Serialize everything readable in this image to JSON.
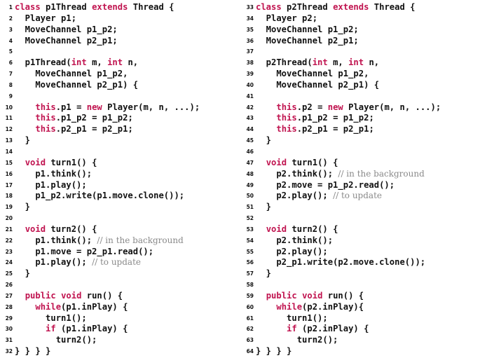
{
  "colors": {
    "keyword": "#c0134f",
    "comment": "#8a8a8a",
    "text": "#111111",
    "background": "#ffffff"
  },
  "listings": [
    {
      "name": "p1Thread",
      "lines": [
        {
          "n": "1",
          "parts": [
            {
              "t": "kw",
              "s": "class"
            },
            {
              "t": "c",
              "s": " p1Thread "
            },
            {
              "t": "kw",
              "s": "extends"
            },
            {
              "t": "c",
              "s": " Thread {"
            }
          ]
        },
        {
          "n": "2",
          "parts": [
            {
              "t": "c",
              "s": "  Player p1;"
            }
          ]
        },
        {
          "n": "3",
          "parts": [
            {
              "t": "c",
              "s": "  MoveChannel p1_p2;"
            }
          ]
        },
        {
          "n": "4",
          "parts": [
            {
              "t": "c",
              "s": "  MoveChannel p2_p1;"
            }
          ]
        },
        {
          "n": "5",
          "parts": []
        },
        {
          "n": "6",
          "parts": [
            {
              "t": "c",
              "s": "  p1Thread("
            },
            {
              "t": "kw",
              "s": "int"
            },
            {
              "t": "c",
              "s": " m, "
            },
            {
              "t": "kw",
              "s": "int"
            },
            {
              "t": "c",
              "s": " n,"
            }
          ]
        },
        {
          "n": "7",
          "parts": [
            {
              "t": "c",
              "s": "    MoveChannel p1_p2,"
            }
          ]
        },
        {
          "n": "8",
          "parts": [
            {
              "t": "c",
              "s": "    MoveChannel p2_p1) {"
            }
          ]
        },
        {
          "n": "9",
          "parts": []
        },
        {
          "n": "10",
          "parts": [
            {
              "t": "c",
              "s": "    "
            },
            {
              "t": "kw",
              "s": "this"
            },
            {
              "t": "c",
              "s": ".p1 = "
            },
            {
              "t": "kw",
              "s": "new"
            },
            {
              "t": "c",
              "s": " Player(m, n, ...);"
            }
          ]
        },
        {
          "n": "11",
          "parts": [
            {
              "t": "c",
              "s": "    "
            },
            {
              "t": "kw",
              "s": "this"
            },
            {
              "t": "c",
              "s": ".p1_p2 = p1_p2;"
            }
          ]
        },
        {
          "n": "12",
          "parts": [
            {
              "t": "c",
              "s": "    "
            },
            {
              "t": "kw",
              "s": "this"
            },
            {
              "t": "c",
              "s": ".p2_p1 = p2_p1;"
            }
          ]
        },
        {
          "n": "13",
          "parts": [
            {
              "t": "c",
              "s": "  }"
            }
          ]
        },
        {
          "n": "14",
          "parts": []
        },
        {
          "n": "15",
          "parts": [
            {
              "t": "c",
              "s": "  "
            },
            {
              "t": "kw",
              "s": "void"
            },
            {
              "t": "c",
              "s": " turn1() {"
            }
          ]
        },
        {
          "n": "16",
          "parts": [
            {
              "t": "c",
              "s": "    p1.think();"
            }
          ]
        },
        {
          "n": "17",
          "parts": [
            {
              "t": "c",
              "s": "    p1.play();"
            }
          ]
        },
        {
          "n": "18",
          "parts": [
            {
              "t": "c",
              "s": "    p1_p2.write(p1.move.clone());"
            }
          ]
        },
        {
          "n": "19",
          "parts": [
            {
              "t": "c",
              "s": "  }"
            }
          ]
        },
        {
          "n": "20",
          "parts": []
        },
        {
          "n": "21",
          "parts": [
            {
              "t": "c",
              "s": "  "
            },
            {
              "t": "kw",
              "s": "void"
            },
            {
              "t": "c",
              "s": " turn2() {"
            }
          ]
        },
        {
          "n": "22",
          "parts": [
            {
              "t": "c",
              "s": "    p1.think(); "
            },
            {
              "t": "cm",
              "s": "// in the background"
            }
          ]
        },
        {
          "n": "23",
          "parts": [
            {
              "t": "c",
              "s": "    p1.move = p2_p1.read();"
            }
          ]
        },
        {
          "n": "24",
          "parts": [
            {
              "t": "c",
              "s": "    p1.play(); "
            },
            {
              "t": "cm",
              "s": "// to update"
            }
          ]
        },
        {
          "n": "25",
          "parts": [
            {
              "t": "c",
              "s": "  }"
            }
          ]
        },
        {
          "n": "26",
          "parts": []
        },
        {
          "n": "27",
          "parts": [
            {
              "t": "c",
              "s": "  "
            },
            {
              "t": "kw",
              "s": "public"
            },
            {
              "t": "c",
              "s": " "
            },
            {
              "t": "kw",
              "s": "void"
            },
            {
              "t": "c",
              "s": " run() {"
            }
          ]
        },
        {
          "n": "28",
          "parts": [
            {
              "t": "c",
              "s": "    "
            },
            {
              "t": "kw",
              "s": "while"
            },
            {
              "t": "c",
              "s": "(p1.inPlay) {"
            }
          ]
        },
        {
          "n": "29",
          "parts": [
            {
              "t": "c",
              "s": "      turn1();"
            }
          ]
        },
        {
          "n": "30",
          "parts": [
            {
              "t": "c",
              "s": "      "
            },
            {
              "t": "kw",
              "s": "if"
            },
            {
              "t": "c",
              "s": " (p1.inPlay) {"
            }
          ]
        },
        {
          "n": "31",
          "parts": [
            {
              "t": "c",
              "s": "        turn2();"
            }
          ]
        },
        {
          "n": "32",
          "parts": [
            {
              "t": "c",
              "s": "} } } }"
            }
          ]
        }
      ]
    },
    {
      "name": "p2Thread",
      "lines": [
        {
          "n": "33",
          "parts": [
            {
              "t": "kw",
              "s": "class"
            },
            {
              "t": "c",
              "s": " p2Thread "
            },
            {
              "t": "kw",
              "s": "extends"
            },
            {
              "t": "c",
              "s": " Thread {"
            }
          ]
        },
        {
          "n": "34",
          "parts": [
            {
              "t": "c",
              "s": "  Player p2;"
            }
          ]
        },
        {
          "n": "35",
          "parts": [
            {
              "t": "c",
              "s": "  MoveChannel p1_p2;"
            }
          ]
        },
        {
          "n": "36",
          "parts": [
            {
              "t": "c",
              "s": "  MoveChannel p2_p1;"
            }
          ]
        },
        {
          "n": "37",
          "parts": []
        },
        {
          "n": "38",
          "parts": [
            {
              "t": "c",
              "s": "  p2Thread("
            },
            {
              "t": "kw",
              "s": "int"
            },
            {
              "t": "c",
              "s": " m, "
            },
            {
              "t": "kw",
              "s": "int"
            },
            {
              "t": "c",
              "s": " n,"
            }
          ]
        },
        {
          "n": "39",
          "parts": [
            {
              "t": "c",
              "s": "    MoveChannel p1_p2,"
            }
          ]
        },
        {
          "n": "40",
          "parts": [
            {
              "t": "c",
              "s": "    MoveChannel p2_p1) {"
            }
          ]
        },
        {
          "n": "41",
          "parts": []
        },
        {
          "n": "42",
          "parts": [
            {
              "t": "c",
              "s": "    "
            },
            {
              "t": "kw",
              "s": "this"
            },
            {
              "t": "c",
              "s": ".p2 = "
            },
            {
              "t": "kw",
              "s": "new"
            },
            {
              "t": "c",
              "s": " Player(m, n, ...);"
            }
          ]
        },
        {
          "n": "43",
          "parts": [
            {
              "t": "c",
              "s": "    "
            },
            {
              "t": "kw",
              "s": "this"
            },
            {
              "t": "c",
              "s": ".p1_p2 = p1_p2;"
            }
          ]
        },
        {
          "n": "44",
          "parts": [
            {
              "t": "c",
              "s": "    "
            },
            {
              "t": "kw",
              "s": "this"
            },
            {
              "t": "c",
              "s": ".p2_p1 = p2_p1;"
            }
          ]
        },
        {
          "n": "45",
          "parts": [
            {
              "t": "c",
              "s": "  }"
            }
          ]
        },
        {
          "n": "46",
          "parts": []
        },
        {
          "n": "47",
          "parts": [
            {
              "t": "c",
              "s": "  "
            },
            {
              "t": "kw",
              "s": "void"
            },
            {
              "t": "c",
              "s": " turn1() {"
            }
          ]
        },
        {
          "n": "48",
          "parts": [
            {
              "t": "c",
              "s": "    p2.think(); "
            },
            {
              "t": "cm",
              "s": "// in the background"
            }
          ]
        },
        {
          "n": "49",
          "parts": [
            {
              "t": "c",
              "s": "    p2.move = p1_p2.read();"
            }
          ]
        },
        {
          "n": "50",
          "parts": [
            {
              "t": "c",
              "s": "    p2.play(); "
            },
            {
              "t": "cm",
              "s": "// to update"
            }
          ]
        },
        {
          "n": "51",
          "parts": [
            {
              "t": "c",
              "s": "  }"
            }
          ]
        },
        {
          "n": "52",
          "parts": []
        },
        {
          "n": "53",
          "parts": [
            {
              "t": "c",
              "s": "  "
            },
            {
              "t": "kw",
              "s": "void"
            },
            {
              "t": "c",
              "s": " turn2() {"
            }
          ]
        },
        {
          "n": "54",
          "parts": [
            {
              "t": "c",
              "s": "    p2.think();"
            }
          ]
        },
        {
          "n": "55",
          "parts": [
            {
              "t": "c",
              "s": "    p2.play();"
            }
          ]
        },
        {
          "n": "56",
          "parts": [
            {
              "t": "c",
              "s": "    p2_p1.write(p2.move.clone());"
            }
          ]
        },
        {
          "n": "57",
          "parts": [
            {
              "t": "c",
              "s": "  }"
            }
          ]
        },
        {
          "n": "58",
          "parts": []
        },
        {
          "n": "59",
          "parts": [
            {
              "t": "c",
              "s": "  "
            },
            {
              "t": "kw",
              "s": "public"
            },
            {
              "t": "c",
              "s": " "
            },
            {
              "t": "kw",
              "s": "void"
            },
            {
              "t": "c",
              "s": " run() {"
            }
          ]
        },
        {
          "n": "60",
          "parts": [
            {
              "t": "c",
              "s": "    "
            },
            {
              "t": "kw",
              "s": "while"
            },
            {
              "t": "c",
              "s": "(p2.inPlay){"
            }
          ]
        },
        {
          "n": "61",
          "parts": [
            {
              "t": "c",
              "s": "      turn1();"
            }
          ]
        },
        {
          "n": "62",
          "parts": [
            {
              "t": "c",
              "s": "      "
            },
            {
              "t": "kw",
              "s": "if"
            },
            {
              "t": "c",
              "s": " (p2.inPlay) {"
            }
          ]
        },
        {
          "n": "63",
          "parts": [
            {
              "t": "c",
              "s": "        turn2();"
            }
          ]
        },
        {
          "n": "64",
          "parts": [
            {
              "t": "c",
              "s": "} } } }"
            }
          ]
        }
      ]
    }
  ]
}
